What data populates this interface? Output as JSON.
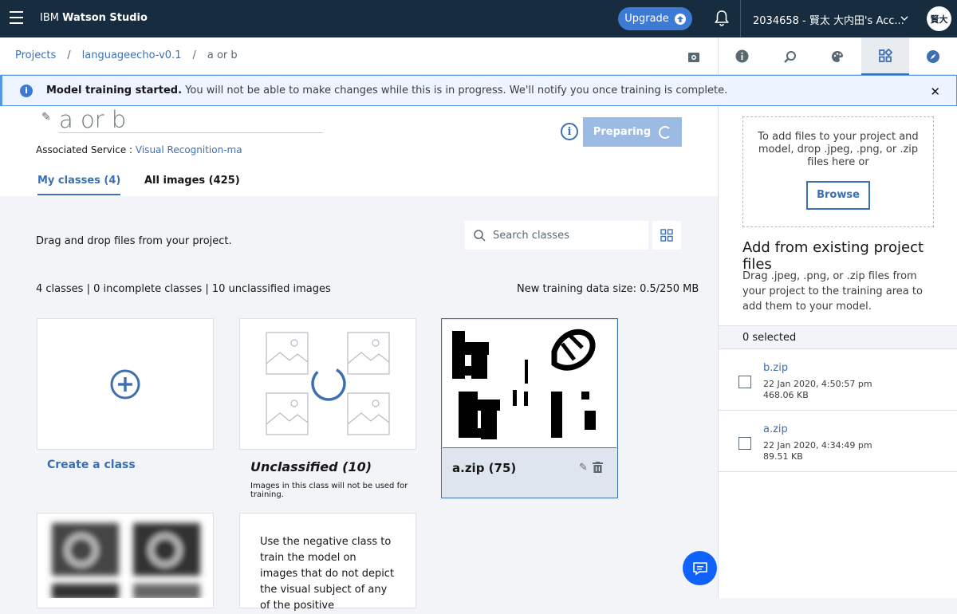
{
  "topbar": {
    "brand_prefix": "IBM",
    "brand_name": "Watson Studio",
    "upgrade_label": "Upgrade",
    "account_label": "2034658 - 賢太 大内田's Acc...",
    "avatar_initials": "賢大"
  },
  "breadcrumb": {
    "items": [
      "Projects",
      "languageecho-v0.1",
      "a or b"
    ],
    "separator": "/"
  },
  "panel_tabs": [
    "info-icon",
    "find-icon",
    "palette-icon",
    "data-icon",
    "compass-icon"
  ],
  "notice": {
    "title": "Model training started.",
    "message": "You will not be able to make changes while this is in progress. We'll notify you once training is complete."
  },
  "model": {
    "name": "a or b",
    "assoc_label": "Associated Service :",
    "assoc_service": "Visual Recognition-ma",
    "button_label": "Preparing"
  },
  "tabs": {
    "my_classes": "My classes (4)",
    "all_images": "All images (425)"
  },
  "toolbar": {
    "drag_text": "Drag and drop files from your project.",
    "search_placeholder": "Search classes",
    "stats": "4 classes | 0 incomplete classes | 10 unclassified images",
    "size_text": "New training data size: 0.5/250 MB"
  },
  "cards": {
    "create_label": "Create a class",
    "unclassified_title": "Unclassified (10)",
    "unclassified_note": "Images in this class will not be used for training.",
    "azip_title": "a.zip (75)",
    "negative_text": "Use the negative class to train the model on images that do not depict the visual subject of any of the positive"
  },
  "right_panel": {
    "dropzone_text": "To add files to your project and model, drop .jpeg, .png, or .zip files here or",
    "browse_label": "Browse",
    "add_title": "Add from existing project files",
    "add_desc": "Drag .jpeg, .png, or .zip files from your project to the training area to add them to your model.",
    "selected": "0 selected",
    "files": [
      {
        "name": "b.zip",
        "date": "22 Jan 2020, 4:50:57 pm",
        "size": "468.06 KB"
      },
      {
        "name": "a.zip",
        "date": "22 Jan 2020, 4:34:49 pm",
        "size": "89.51 KB"
      }
    ]
  },
  "colors": {
    "topbar": "#172c3f",
    "accent": "#3d70b2",
    "upgrade": "#3c7ad6",
    "chat": "#0f62fe"
  }
}
